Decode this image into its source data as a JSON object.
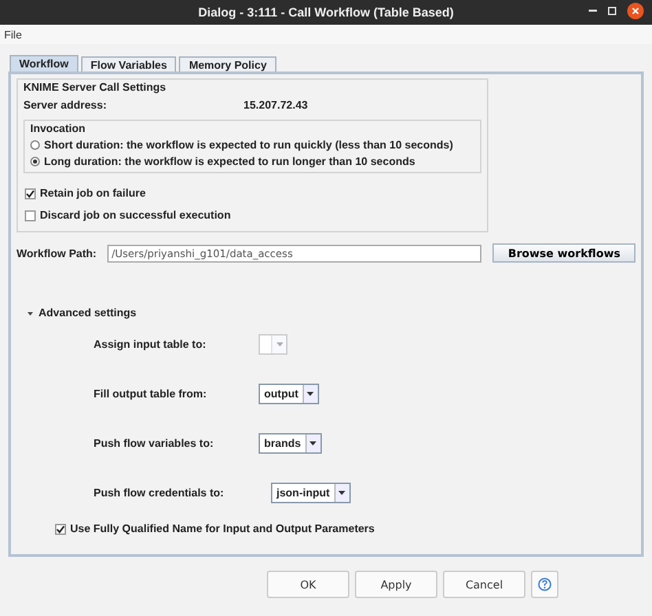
{
  "window": {
    "title": "Dialog - 3:111 - Call Workflow (Table Based)"
  },
  "menu": [
    "File"
  ],
  "tabs": [
    {
      "label": "Workflow",
      "selected": true
    },
    {
      "label": "Flow Variables",
      "selected": false
    },
    {
      "label": "Memory Policy",
      "selected": false
    }
  ],
  "server_settings": {
    "title": "KNIME Server Call Settings",
    "address_label": "Server address:",
    "address": "15.207.72.43",
    "invocation": {
      "title": "Invocation",
      "options": [
        {
          "label": "Short duration: the workflow is expected to run quickly (less than 10 seconds)",
          "selected": false
        },
        {
          "label": "Long duration: the workflow is expected to run longer than 10 seconds",
          "selected": true
        }
      ]
    },
    "checkboxes": [
      {
        "label": "Retain job on failure",
        "checked": true
      },
      {
        "label": "Discard job on successful execution",
        "checked": false
      }
    ]
  },
  "workflow_path": {
    "label": "Workflow Path:",
    "value": "/Users/priyanshi_g101/data_access",
    "button": "Browse workflows"
  },
  "advanced": {
    "label": "Advanced settings",
    "expanded": true,
    "rows": [
      {
        "label": "Assign input table to:",
        "disabled": true
      },
      {
        "label": "Fill output table from:",
        "value": "output",
        "disabled": false
      },
      {
        "label": "Push flow variables to:",
        "value": "brands",
        "disabled": false
      },
      {
        "label": "Push flow credentials to:",
        "value": "json-input",
        "disabled": false
      }
    ],
    "fully_qualified": {
      "label": "Use Fully Qualified Name for Input and Output Parameters",
      "checked": true
    }
  },
  "buttons": [
    "OK",
    "Apply",
    "Cancel"
  ]
}
